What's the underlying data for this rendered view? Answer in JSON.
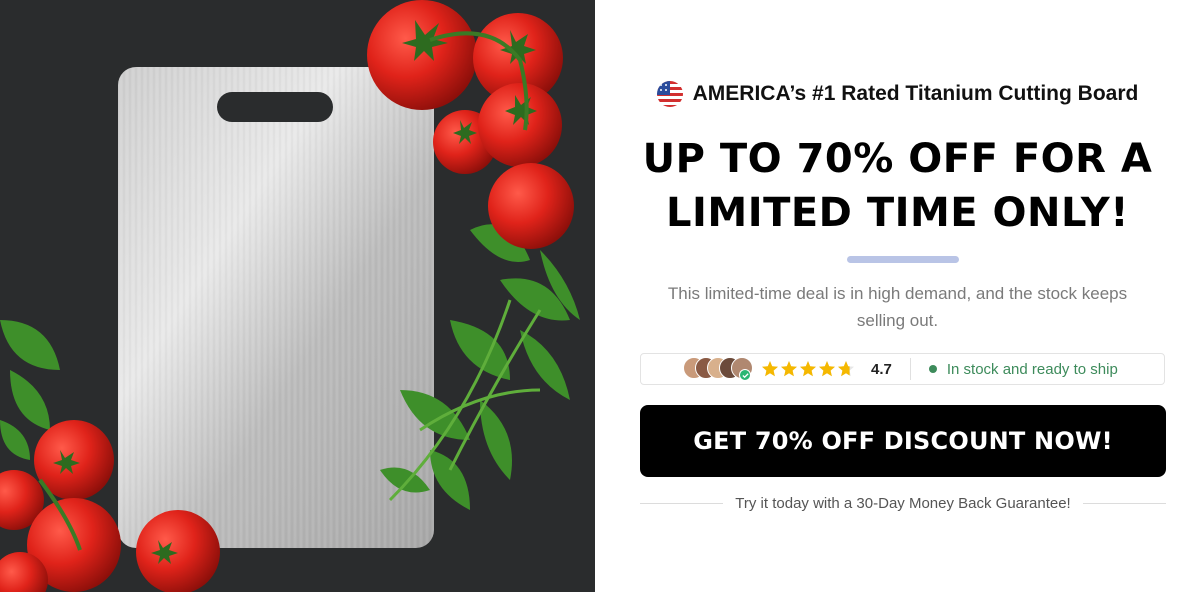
{
  "hero": {
    "image_alt": "Titanium cutting board with tomatoes and parsley"
  },
  "offer": {
    "badge_icon": "us-flag-icon",
    "badge_text": "AMERICA’s #1 Rated Titanium Cutting Board",
    "headline_line1": "UP TO 70% OFF FOR A",
    "headline_line2": "LIMITED TIME ONLY!",
    "subtext": "This limited-time deal is in high demand, and the stock keeps selling out.",
    "rating": {
      "stars": 4.7,
      "value_text": "4.7",
      "star_color": "#f5b800"
    },
    "stock": {
      "text": "In stock and ready to ship",
      "color": "#3d8b5b"
    },
    "cta_label": "GET 70% OFF DISCOUNT NOW!",
    "guarantee_text": "Try it today with a 30-Day Money Back Guarantee!",
    "accent_color": "#b9c4e6"
  }
}
